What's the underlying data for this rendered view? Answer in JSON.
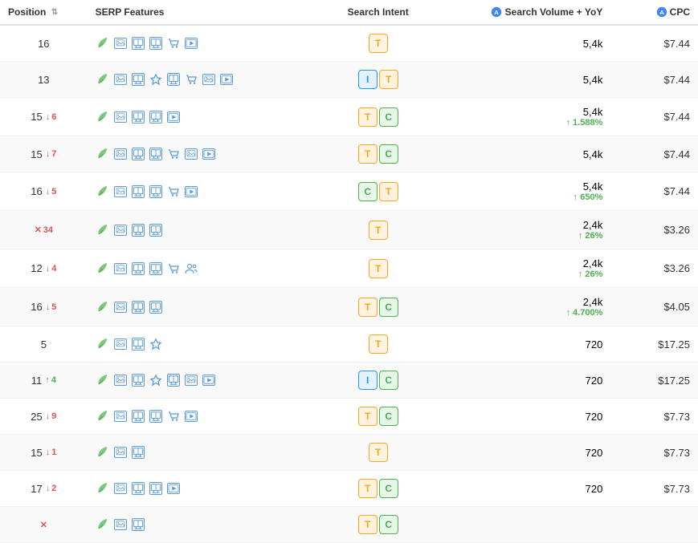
{
  "header": {
    "position": "Position",
    "serp_features": "SERP Features",
    "search_intent": "Search Intent",
    "volume_label": "Search Volume + YoY",
    "cpc_label": "CPC"
  },
  "rows": [
    {
      "position": 16,
      "change": null,
      "serp_icons": [
        "leaf",
        "image",
        "local",
        "local",
        "shopping",
        "video"
      ],
      "intent": [
        "T"
      ],
      "volume": "5,4k",
      "yoy": null,
      "cpc": "$7.44"
    },
    {
      "position": 13,
      "change": null,
      "serp_icons": [
        "leaf",
        "image",
        "local",
        "star",
        "local",
        "shopping",
        "image2",
        "video"
      ],
      "intent": [
        "I",
        "T"
      ],
      "volume": "5,4k",
      "yoy": null,
      "cpc": "$7.44"
    },
    {
      "position": 15,
      "change": {
        "dir": "down",
        "val": 6
      },
      "serp_icons": [
        "leaf",
        "image",
        "local",
        "local",
        "video"
      ],
      "intent": [
        "T",
        "C"
      ],
      "volume": "5,4k",
      "yoy": "↑ 1.588%",
      "yoy_pos": true,
      "cpc": "$7.44"
    },
    {
      "position": 15,
      "change": {
        "dir": "down",
        "val": 7
      },
      "serp_icons": [
        "leaf",
        "image",
        "local",
        "local",
        "shopping",
        "image2",
        "video"
      ],
      "intent": [
        "T",
        "C"
      ],
      "volume": "5,4k",
      "yoy": null,
      "cpc": "$7.44"
    },
    {
      "position": 16,
      "change": {
        "dir": "down",
        "val": 5
      },
      "serp_icons": [
        "leaf",
        "image",
        "local",
        "local",
        "shopping",
        "video"
      ],
      "intent": [
        "C",
        "T"
      ],
      "volume": "5,4k",
      "yoy": "↑ 650%",
      "yoy_pos": true,
      "cpc": "$7.44"
    },
    {
      "position": null,
      "change": {
        "dir": "x",
        "val": 34
      },
      "serp_icons": [
        "leaf",
        "image",
        "local",
        "local"
      ],
      "intent": [
        "T"
      ],
      "volume": "2,4k",
      "yoy": "↑ 26%",
      "yoy_pos": true,
      "cpc": "$3.26"
    },
    {
      "position": 12,
      "change": {
        "dir": "down",
        "val": 4
      },
      "serp_icons": [
        "leaf",
        "image",
        "local",
        "local",
        "shopping",
        "people"
      ],
      "intent": [
        "T"
      ],
      "volume": "2,4k",
      "yoy": "↑ 26%",
      "yoy_pos": true,
      "cpc": "$3.26"
    },
    {
      "position": 16,
      "change": {
        "dir": "down",
        "val": 5
      },
      "serp_icons": [
        "leaf",
        "image",
        "local",
        "local"
      ],
      "intent": [
        "T",
        "C"
      ],
      "volume": "2,4k",
      "yoy": "↑ 4.700%",
      "yoy_pos": true,
      "cpc": "$4.05"
    },
    {
      "position": 5,
      "change": null,
      "serp_icons": [
        "leaf",
        "image",
        "local",
        "star"
      ],
      "intent": [
        "T"
      ],
      "volume": "720",
      "yoy": null,
      "cpc": "$17.25"
    },
    {
      "position": 11,
      "change": {
        "dir": "up",
        "val": 4
      },
      "serp_icons": [
        "leaf",
        "image",
        "local",
        "star",
        "local",
        "image2",
        "video"
      ],
      "intent": [
        "I",
        "C"
      ],
      "volume": "720",
      "yoy": null,
      "cpc": "$17.25"
    },
    {
      "position": 25,
      "change": {
        "dir": "down",
        "val": 9
      },
      "serp_icons": [
        "leaf",
        "image",
        "local",
        "local",
        "shopping",
        "video"
      ],
      "intent": [
        "T",
        "C"
      ],
      "volume": "720",
      "yoy": null,
      "cpc": "$7.73"
    },
    {
      "position": 15,
      "change": {
        "dir": "down",
        "val": 1
      },
      "serp_icons": [
        "leaf",
        "image",
        "local"
      ],
      "intent": [
        "T"
      ],
      "volume": "720",
      "yoy": null,
      "cpc": "$7.73"
    },
    {
      "position": 17,
      "change": {
        "dir": "down",
        "val": 2
      },
      "serp_icons": [
        "leaf",
        "image",
        "local",
        "local",
        "video"
      ],
      "intent": [
        "T",
        "C"
      ],
      "volume": "720",
      "yoy": null,
      "cpc": "$7.73"
    },
    {
      "position": null,
      "change": {
        "dir": "x",
        "val": null
      },
      "serp_icons": [
        "leaf",
        "image",
        "local"
      ],
      "intent": [
        "T",
        "C"
      ],
      "volume": null,
      "yoy": null,
      "cpc": null
    }
  ]
}
